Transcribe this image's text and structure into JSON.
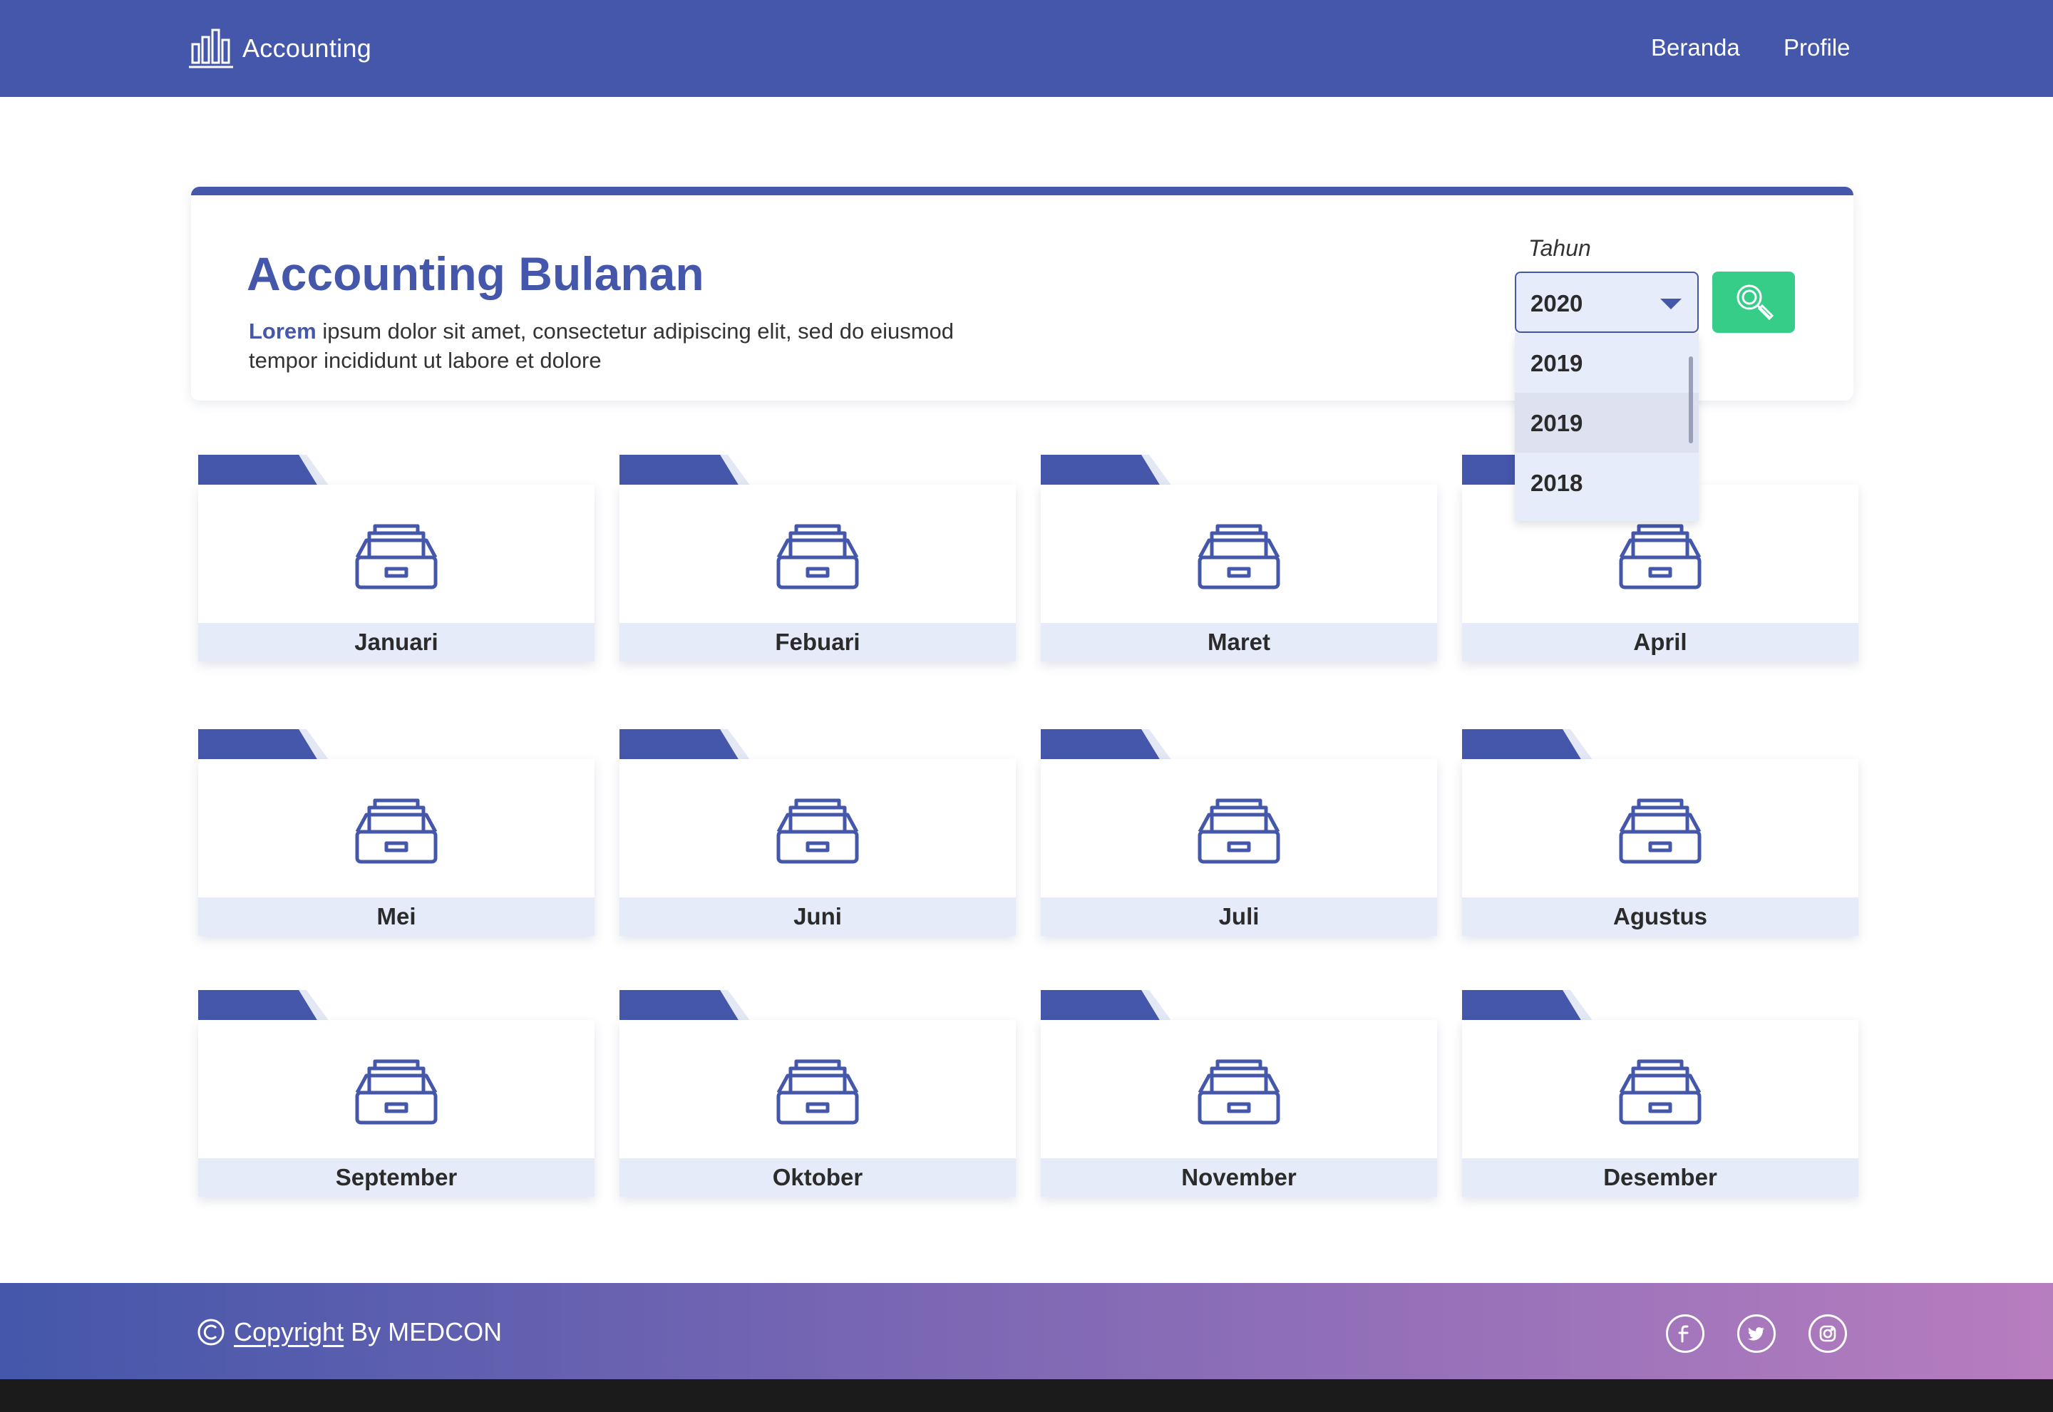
{
  "nav": {
    "brand": "Accounting",
    "links": [
      "Beranda",
      "Profile"
    ]
  },
  "header": {
    "title": "Accounting Bulanan",
    "desc_lead": "Lorem",
    "desc_rest": " ipsum dolor sit amet, consectetur adipiscing elit, sed do eiusmod tempor incididunt ut labore et dolore"
  },
  "filter": {
    "label": "Tahun",
    "selected": "2020",
    "options": [
      "2019",
      "2019",
      "2018"
    ]
  },
  "months": [
    "Januari",
    "Febuari",
    "Maret",
    "April",
    "Mei",
    "Juni",
    "Juli",
    "Agustus",
    "September",
    "Oktober",
    "November",
    "Desember"
  ],
  "footer": {
    "copyright_link": "Copyright",
    "copyright_rest": "By MEDCON",
    "social": [
      "facebook-icon",
      "twitter-icon",
      "instagram-icon"
    ]
  },
  "colors": {
    "primary": "#4457aa",
    "search_button": "#35cd87",
    "card_label_bg": "#e6ebf9",
    "footer_gradient_start": "#4457aa",
    "footer_gradient_end": "#b77dbf"
  }
}
